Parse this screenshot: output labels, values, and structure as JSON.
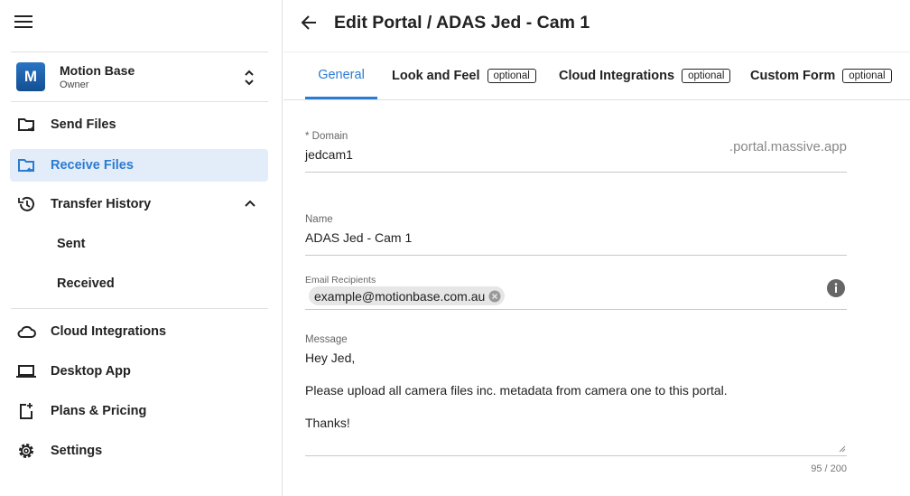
{
  "sidebar": {
    "account": {
      "initial": "M",
      "name": "Motion Base",
      "role": "Owner"
    },
    "items": [
      {
        "label": "Send Files",
        "icon": "folder-send-icon"
      },
      {
        "label": "Receive Files",
        "icon": "folder-receive-icon",
        "active": true
      },
      {
        "label": "Transfer History",
        "icon": "history-icon"
      },
      {
        "label": "Cloud Integrations",
        "icon": "cloud-icon"
      },
      {
        "label": "Desktop App",
        "icon": "laptop-icon"
      },
      {
        "label": "Plans & Pricing",
        "icon": "plans-icon"
      },
      {
        "label": "Settings",
        "icon": "gear-icon"
      }
    ],
    "history_sub": [
      "Sent",
      "Received"
    ]
  },
  "header": {
    "title": "Edit Portal / ADAS Jed - Cam 1"
  },
  "tabs": [
    {
      "label": "General",
      "active": true
    },
    {
      "label": "Look and Feel",
      "badge": "optional"
    },
    {
      "label": "Cloud Integrations",
      "badge": "optional"
    },
    {
      "label": "Custom Form",
      "badge": "optional"
    }
  ],
  "form": {
    "domain": {
      "label": "* Domain",
      "value": "jedcam1",
      "suffix": ".portal.massive.app"
    },
    "name": {
      "label": "Name",
      "value": "ADAS Jed - Cam 1"
    },
    "email": {
      "label": "Email Recipients",
      "chip": "example@motionbase.com.au"
    },
    "message": {
      "label": "Message",
      "lines": [
        "Hey Jed,",
        "Please upload all camera files inc. metadata from camera one to this portal.",
        "Thanks!"
      ],
      "counter": "95 / 200"
    }
  },
  "colors": {
    "accent": "#2a7bd1",
    "active_bg": "#e3edf9",
    "avatar": "#1a5fa8"
  }
}
